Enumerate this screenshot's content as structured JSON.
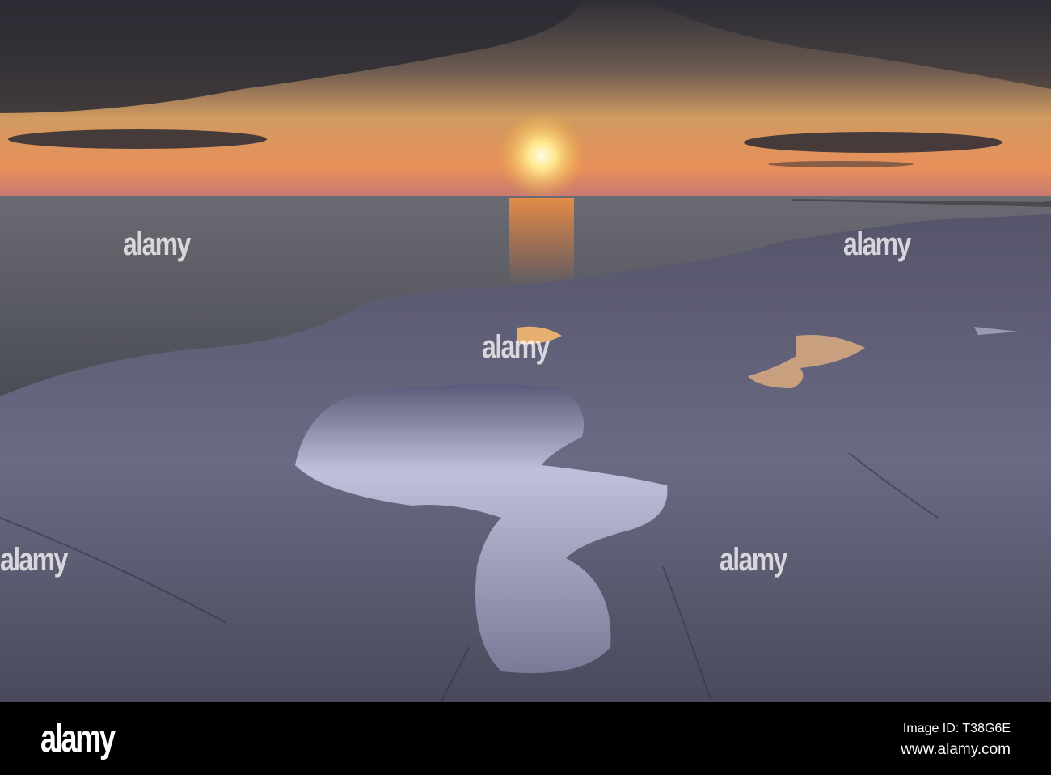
{
  "photo": {
    "subject": "sunset-over-sea-rock-pools",
    "colors": {
      "sky_dark": "#3a3a44",
      "sky_glow": "#f0a050",
      "sun": "#fff8d0",
      "sea": "#5a5c62",
      "rock": "#4a4a5c",
      "pool": "#8a8aa8"
    }
  },
  "watermark": {
    "text": "alamy"
  },
  "footer": {
    "logo": "alamy",
    "image_id": "Image ID: T38G6E",
    "website": "www.alamy.com"
  }
}
